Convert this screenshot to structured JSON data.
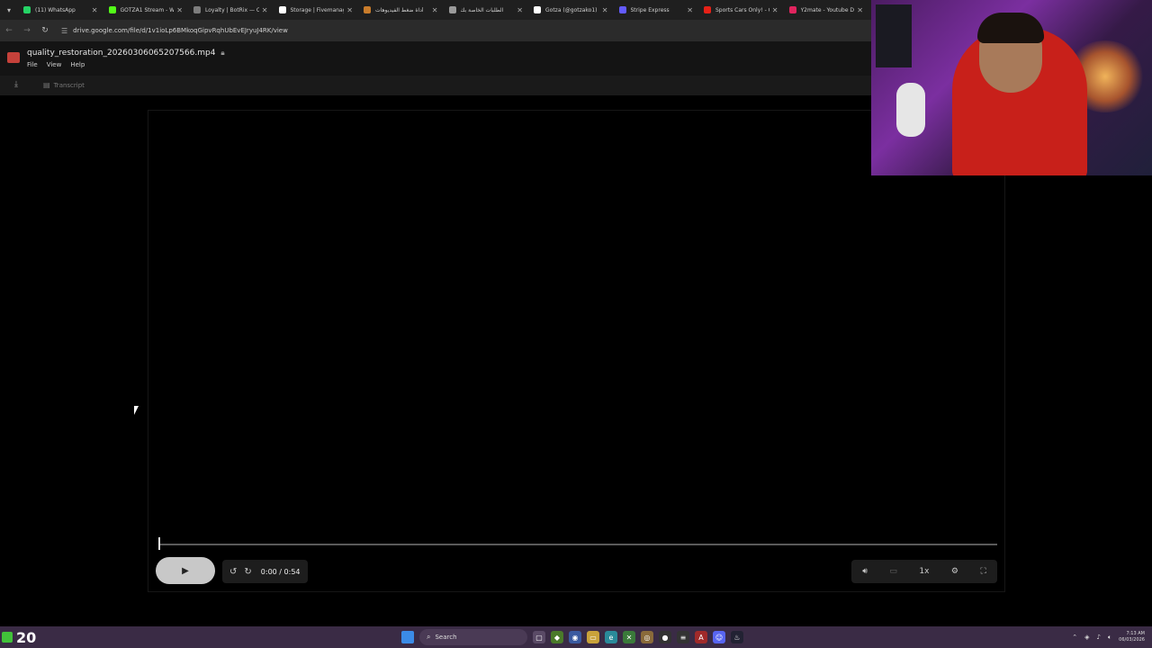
{
  "browser": {
    "tabs": [
      {
        "title": "(11) WhatsApp",
        "color": "#25d366"
      },
      {
        "title": "GOTZA1 Stream - W",
        "color": "#53fc18"
      },
      {
        "title": "Loyalty | BotRix — C",
        "color": "#7d7d7d"
      },
      {
        "title": "Storage | Fivemanage",
        "color": "#ffffff"
      },
      {
        "title": "أداة ضغط الفيديوهات",
        "color": "#c97c2b"
      },
      {
        "title": "الطلبات الخاصة بك",
        "color": "#9a9a9a"
      },
      {
        "title": "Gotza (@gotzako1) |",
        "color": "#ffffff"
      },
      {
        "title": "Stripe Express",
        "color": "#635bff"
      },
      {
        "title": "Sports Cars Only! - G",
        "color": "#e62117"
      },
      {
        "title": "Y2mate - Youtube Do",
        "color": "#e0245e"
      }
    ],
    "url": "drive.google.com/file/d/1v1ioLp6BMkoqGipvRqhUbEvEJryuJ4RK/view"
  },
  "drive": {
    "file_name": "quality_restoration_20260306065207566.mp4",
    "menu": [
      "File",
      "View",
      "Help"
    ],
    "transcript_label": "Transcript"
  },
  "player": {
    "time": "0:00 / 0:54",
    "progress": 0.0,
    "speed": "1x"
  },
  "taskbar": {
    "badge_number": "20",
    "search_placeholder": "Search",
    "clock_time": "7:13 AM",
    "clock_date": "06/03/2026"
  },
  "colors": {
    "taskbar_bg": "#3a2b45",
    "accent_green": "#41c23a"
  }
}
